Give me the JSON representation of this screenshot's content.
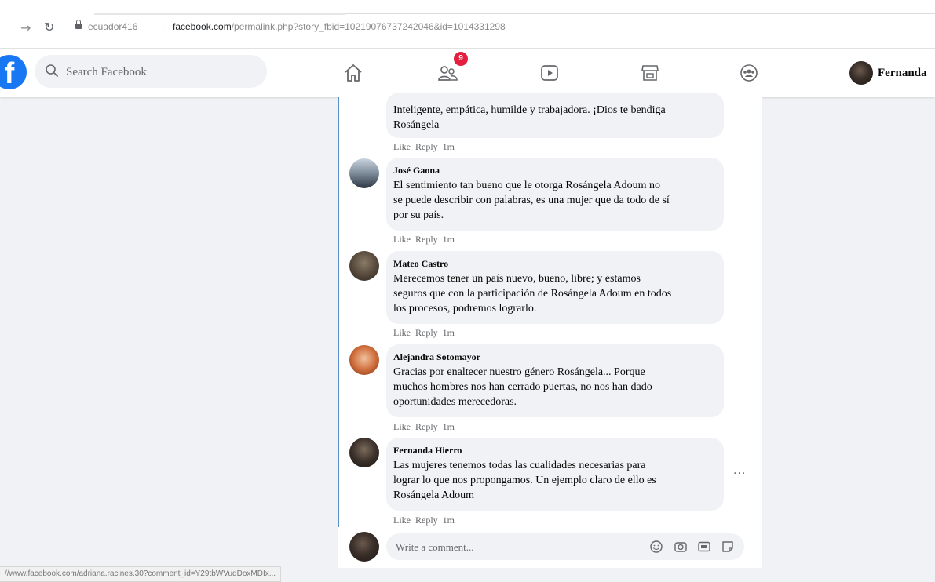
{
  "browser": {
    "site_label": "ecuador416",
    "separator": "|",
    "url_domain": "facebook.com",
    "url_path": "/permalink.php?story_fbid=10219076737242046&id=1014331298",
    "status_url": "//www.facebook.com/adriana.racines.30?comment_id=Y29tbWVudDoxMDIx..."
  },
  "header": {
    "logo": "f",
    "search_placeholder": "Search Facebook",
    "friends_badge": "9",
    "profile_name": "Fernanda"
  },
  "comments": [
    {
      "author": "",
      "lines": [
        "Inteligente, empática, humilde y trabajadora. ¡Dios te bendiga",
        "Rosángela"
      ],
      "like": "Like",
      "reply": "Reply",
      "time": "1m"
    },
    {
      "author": "José Gaona",
      "lines": [
        "El sentimiento tan bueno que le otorga Rosángela Adoum no",
        "se puede describir con palabras, es una mujer que da todo de sí",
        "por su país."
      ],
      "like": "Like",
      "reply": "Reply",
      "time": "1m"
    },
    {
      "author": "Mateo Castro",
      "lines": [
        "Merecemos tener un país nuevo, bueno, libre; y estamos",
        "seguros que con la participación de Rosángela Adoum en todos",
        "los procesos, podremos lograrlo."
      ],
      "like": "Like",
      "reply": "Reply",
      "time": "1m"
    },
    {
      "author": "Alejandra Sotomayor",
      "lines": [
        "Gracias por enaltecer nuestro género Rosángela... Porque",
        "muchos hombres nos han cerrado puertas, no nos han dado",
        "oportunidades merecedoras."
      ],
      "like": "Like",
      "reply": "Reply",
      "time": "1m"
    },
    {
      "author": "Fernanda Hierro",
      "lines": [
        "Las mujeres tenemos todas las cualidades necesarias para",
        "lograr lo que nos propongamos. Un ejemplo claro de ello es",
        "Rosángela Adoum"
      ],
      "like": "Like",
      "reply": "Reply",
      "time": "1m"
    }
  ],
  "composer": {
    "placeholder": "Write a comment..."
  },
  "colors": {
    "brand": "#1877f2",
    "badge": "#e41e3f",
    "bubble": "#f0f2f5",
    "thread_line": "#5a8fd0"
  }
}
